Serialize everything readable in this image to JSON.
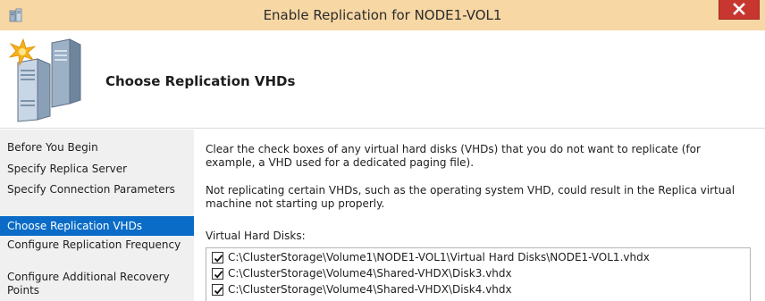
{
  "window": {
    "title": "Enable Replication for NODE1-VOL1",
    "app_icon": "replication-app-icon",
    "close_icon": "close-icon"
  },
  "header": {
    "page_title": "Choose Replication VHDs",
    "logo_icon": "replication-wizard-icon"
  },
  "sidebar": {
    "items": [
      {
        "label": "Before You Begin",
        "active": false
      },
      {
        "label": "Specify Replica Server",
        "active": false
      },
      {
        "label": "Specify Connection Parameters",
        "active": false
      },
      {
        "label": "Choose Replication VHDs",
        "active": true
      },
      {
        "label": "Configure Replication Frequency",
        "active": false
      },
      {
        "label": "Configure Additional Recovery Points",
        "active": false
      }
    ]
  },
  "content": {
    "intro": "Clear the check boxes of any virtual hard disks (VHDs) that you do not want to replicate (for example, a VHD used for a dedicated paging file).",
    "warning": "Not replicating certain VHDs, such as the operating system VHD, could result in the Replica virtual machine not starting up properly.",
    "list_label": "Virtual Hard Disks:",
    "vhds": [
      {
        "path": "C:\\ClusterStorage\\Volume1\\NODE1-VOL1\\Virtual Hard Disks\\NODE1-VOL1.vhdx",
        "checked": true
      },
      {
        "path": "C:\\ClusterStorage\\Volume4\\Shared-VHDX\\Disk3.vhdx",
        "checked": true
      },
      {
        "path": "C:\\ClusterStorage\\Volume4\\Shared-VHDX\\Disk4.vhdx",
        "checked": true
      }
    ]
  },
  "colors": {
    "titlebar": "#f7d7a4",
    "close_button": "#c7372f",
    "nav_active": "#0a6cc7",
    "sidebar_bg": "#f0f0f0"
  }
}
